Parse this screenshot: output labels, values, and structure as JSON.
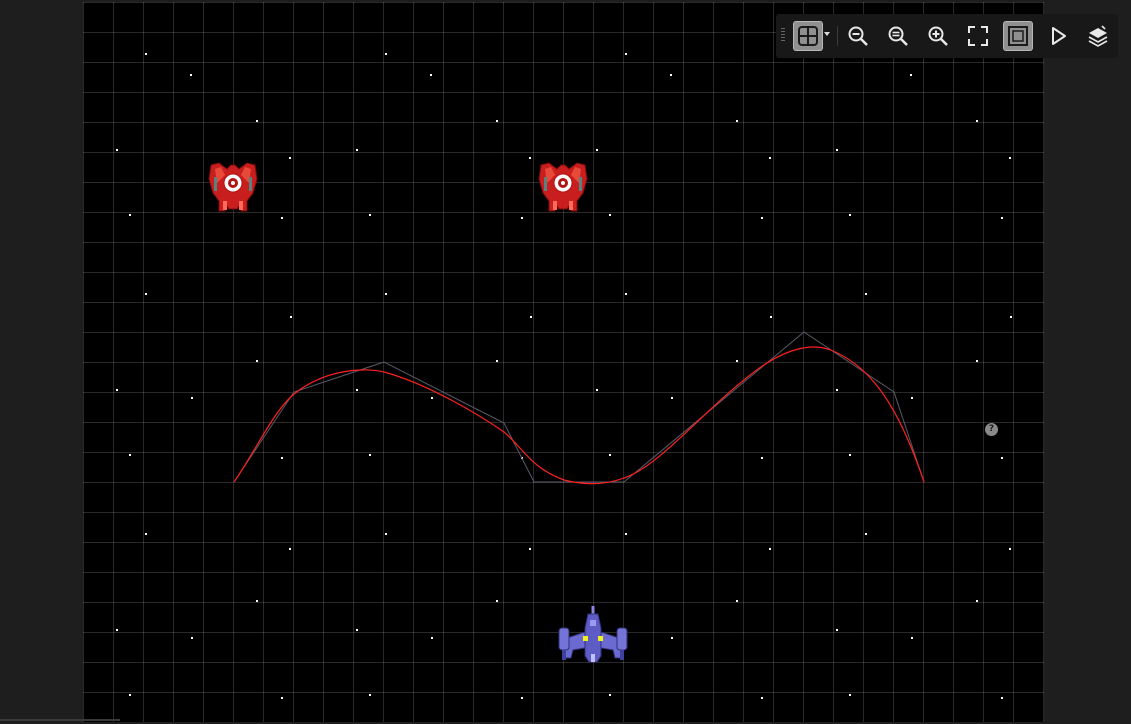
{
  "scene": {
    "grid_visible": true,
    "background_color": "#000000",
    "path_color": "#ff2020",
    "control_polygon_color": "#5a5a6a",
    "enemies": [
      {
        "name": "red-enemy-ship"
      },
      {
        "name": "red-enemy-ship"
      }
    ],
    "player": {
      "name": "purple-player-ship"
    }
  },
  "toolbar": {
    "buttons": [
      {
        "name": "grid-snap-button",
        "icon": "grid-icon",
        "active": true
      },
      {
        "name": "zoom-out-button",
        "icon": "zoom-out-icon",
        "active": false
      },
      {
        "name": "zoom-reset-button",
        "icon": "zoom-reset-icon",
        "active": false
      },
      {
        "name": "zoom-in-button",
        "icon": "zoom-in-icon",
        "active": false
      },
      {
        "name": "fullscreen-button",
        "icon": "fullscreen-icon",
        "active": false
      },
      {
        "name": "frame-bounds-button",
        "icon": "frame-icon",
        "active": true
      },
      {
        "name": "play-button",
        "icon": "play-icon",
        "active": false
      },
      {
        "name": "layers-button",
        "icon": "layers-icon",
        "active": false
      }
    ]
  },
  "help": {
    "label": "?"
  }
}
